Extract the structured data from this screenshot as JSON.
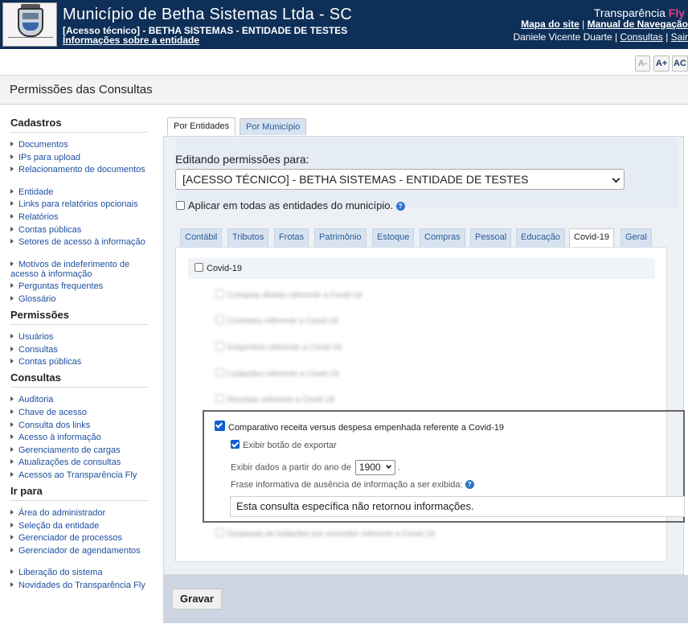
{
  "header": {
    "title": "Município de Betha Sistemas Ltda - SC",
    "subtitle": "[Acesso técnico] - BETHA SISTEMAS - ENTIDADE DE TESTES",
    "info_link": "Informações sobre a entidade",
    "brand": "Transparência",
    "brand_fly": "Fly",
    "sitemap_link": "Mapa do site",
    "manual_link": "Manual de Navegação",
    "user": "Daniele Vicente Duarte",
    "consultas_link": "Consultas",
    "sair_link": "Sair",
    "sep": "|"
  },
  "font_controls": [
    "A-",
    "A+",
    "AC"
  ],
  "page_title": "Permissões das Consultas",
  "sidebar": {
    "sections": [
      {
        "title": "Cadastros",
        "items": [
          "Documentos",
          "IPs para upload",
          "Relacionamento de documentos",
          "Entidade",
          "Links para relatórios opcionais",
          "Relatórios",
          "Contas públicas",
          "Setores de acesso à informação",
          "Motivos de indeferimento de acesso à informação",
          "Perguntas frequentes",
          "Glossário"
        ]
      },
      {
        "title": "Permissões",
        "items": [
          "Usuários",
          "Consultas",
          "Contas públicas"
        ]
      },
      {
        "title": "Consultas",
        "items": [
          "Auditoria",
          "Chave de acesso",
          "Consulta dos links",
          "Acesso à informação",
          "Gerenciamento de cargas",
          "Atualizações de consultas",
          "Acessos ao Transparência Fly"
        ]
      },
      {
        "title": "Ir para",
        "items": [
          "Área do administrador",
          "Seleção da entidade",
          "Gerenciador de processos",
          "Gerenciador de agendamentos",
          "Liberação do sistema",
          "Novidades do Transparência Fly"
        ]
      }
    ]
  },
  "main": {
    "top_tabs": [
      "Por Entidades",
      "Por Município"
    ],
    "editing_label": "Editando permissões para:",
    "entity_select": "[ACESSO TÉCNICO] - BETHA SISTEMAS - ENTIDADE DE TESTES",
    "apply_all_label": "Aplicar em todas as entidades do município.",
    "category_tabs": [
      "Contábil",
      "Tributos",
      "Frotas",
      "Patrimônio",
      "Estoque",
      "Compras",
      "Pessoal",
      "Educação",
      "Covid-19",
      "Geral"
    ],
    "active_category": "Covid-19",
    "group_label": "Covid-19",
    "blurred_items": [
      "Compras diretas referente a Covid-19",
      "Contratos referente a Covid-19",
      "Empenhos referente a Covid-19",
      "Licitações referente a Covid-19",
      "Receitas referente a Covid-19",
      "Despesas de licitações por vencedor referente a Covid-19"
    ],
    "highlighted": {
      "label": "Comparativo receita versus despesa empenhada referente a Covid-19",
      "export_label": "Exibir botão de exportar",
      "year_label": "Exibir dados a partir do ano de",
      "year_value": "1900",
      "year_suffix": ".",
      "phrase_label": "Frase informativa de ausência de informação a ser exibida:",
      "phrase_value": "Esta consulta específica não retornou informações."
    },
    "save_button": "Gravar"
  }
}
